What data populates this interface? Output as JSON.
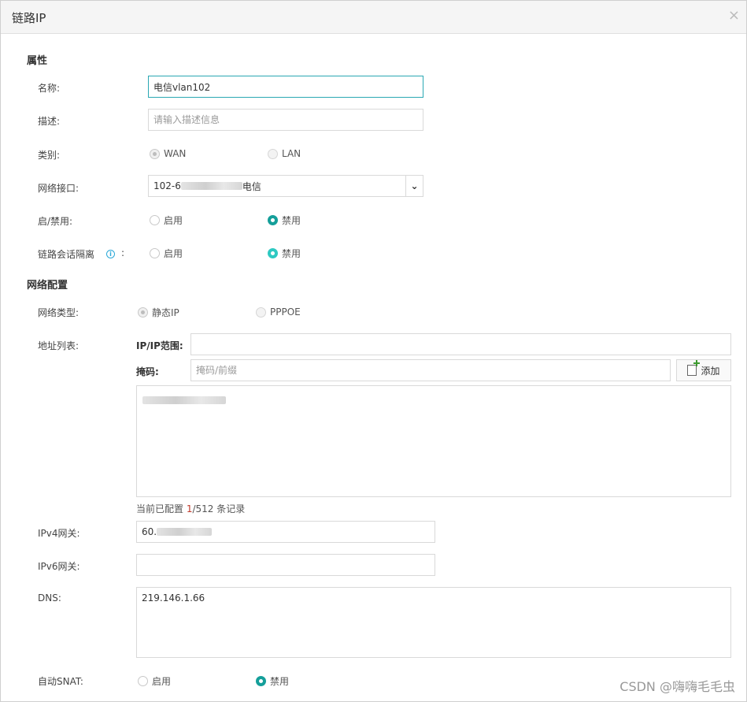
{
  "dialog": {
    "title": "链路IP",
    "close_glyph": "×"
  },
  "sections": {
    "attributes": "属性",
    "network": "网络配置"
  },
  "fields": {
    "name_label": "名称:",
    "name_value": "电信vlan102",
    "desc_label": "描述:",
    "desc_placeholder": "请输入描述信息",
    "category_label": "类别:",
    "category_options": [
      "WAN",
      "LAN"
    ],
    "category_selected": "WAN",
    "interface_label": "网络接口:",
    "interface_value_prefix": "102-6",
    "interface_value_suffix": "电信",
    "enable_label": "启/禁用:",
    "enable_options": [
      "启用",
      "禁用"
    ],
    "enable_selected": "禁用",
    "isolation_label": "链路会话隔离",
    "isolation_colon": ":",
    "isolation_options": [
      "启用",
      "禁用"
    ],
    "isolation_selected": "禁用",
    "nettype_label": "网络类型:",
    "nettype_options": [
      "静态IP",
      "PPPOE"
    ],
    "nettype_selected": "静态IP",
    "addrlist_label": "地址列表:",
    "ip_range_label": "IP/IP范围:",
    "ip_range_value": "",
    "mask_label": "掩码:",
    "mask_placeholder": "掩码/前缀",
    "add_button": "添加",
    "record_count_prefix": "当前已配置 ",
    "record_count_current": "1",
    "record_count_suffix": "/512 条记录",
    "ipv4_gw_label": "IPv4网关:",
    "ipv4_gw_value_prefix": "60.",
    "ipv6_gw_label": "IPv6网关:",
    "ipv6_gw_value": "",
    "dns_label": "DNS:",
    "dns_value": "219.146.1.66",
    "snat_label": "自动SNAT:",
    "snat_options": [
      "启用",
      "禁用"
    ],
    "snat_selected": "禁用"
  },
  "watermark": "CSDN @嗨嗨毛毛虫",
  "colors": {
    "accent": "#159f9a",
    "accent_light": "#2ec9c2",
    "focus_border": "#2aa8b3",
    "count_red": "#c0392b"
  }
}
